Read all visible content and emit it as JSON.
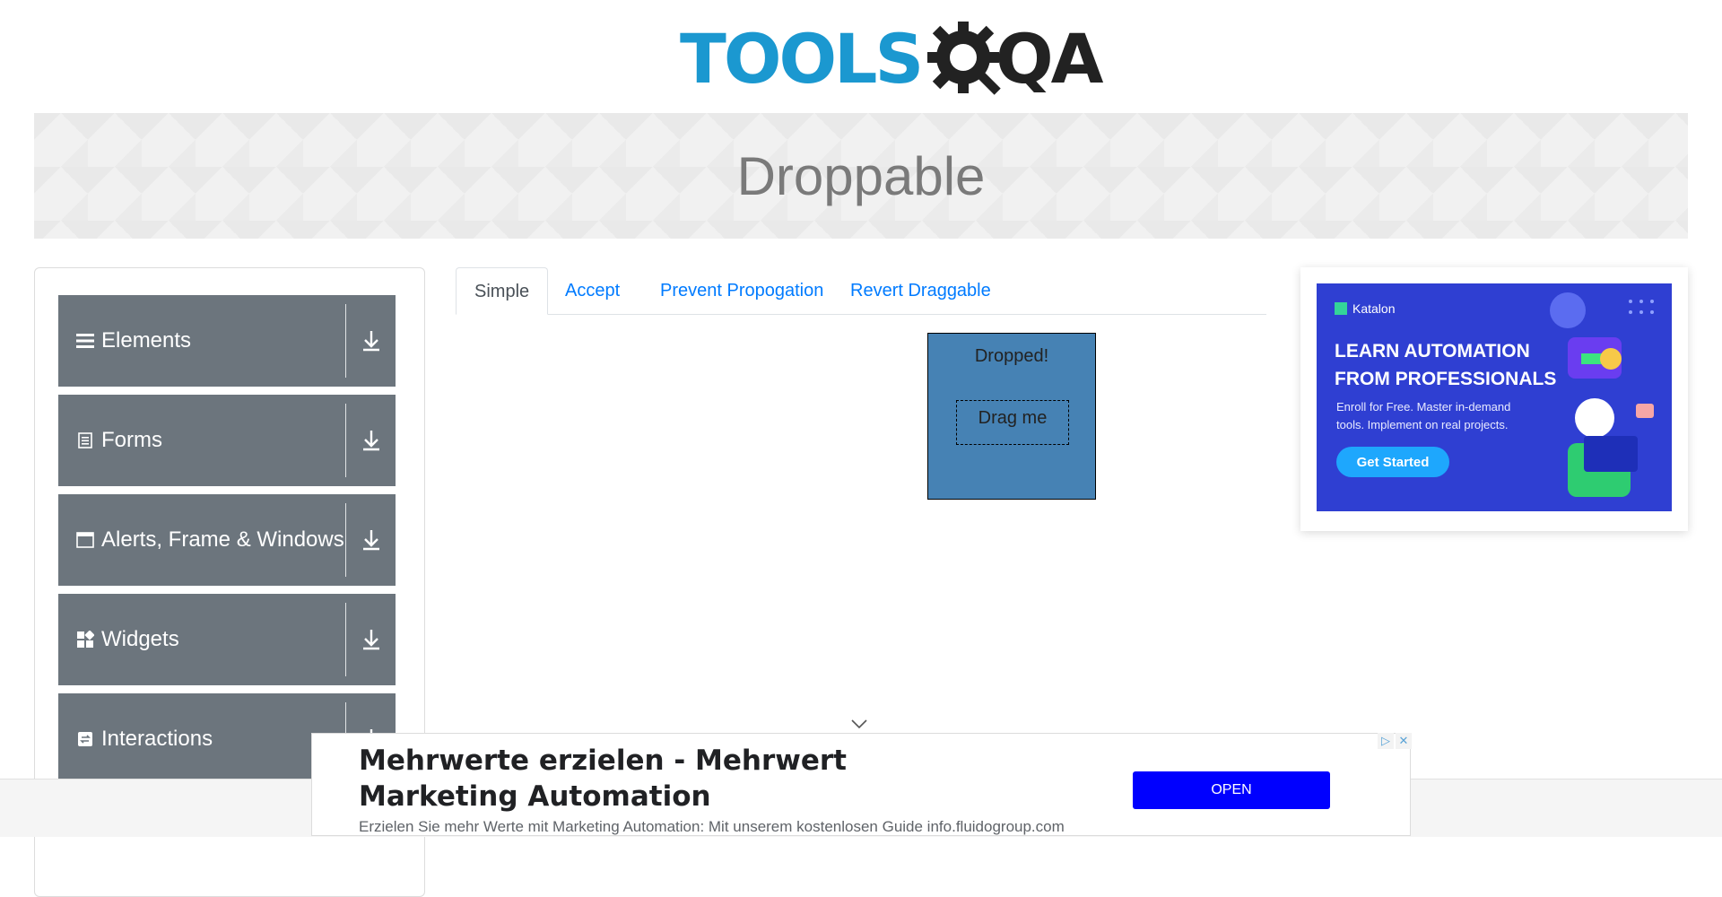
{
  "logo": {
    "part1": "TOOLS",
    "part2": "QA"
  },
  "banner": {
    "title": "Droppable"
  },
  "sidebar": {
    "items": [
      {
        "label": "Elements",
        "icon": "menu-icon"
      },
      {
        "label": "Forms",
        "icon": "document-icon"
      },
      {
        "label": "Alerts, Frame & Windows",
        "icon": "window-icon"
      },
      {
        "label": "Widgets",
        "icon": "widgets-icon"
      },
      {
        "label": "Interactions",
        "icon": "interactions-icon"
      }
    ]
  },
  "tabs": [
    {
      "label": "Simple",
      "active": true
    },
    {
      "label": "Accept"
    },
    {
      "label": "Prevent Propogation"
    },
    {
      "label": "Revert Draggable"
    }
  ],
  "droppable": {
    "drop_text": "Dropped!",
    "drag_text": "Drag me",
    "drop_color": "#4682b4"
  },
  "right_ad": {
    "brand": "Katalon",
    "headline": "LEARN AUTOMATION FROM PROFESSIONALS",
    "sub": "Enroll for Free. Master in-demand tools. Implement on real projects.",
    "button": "Get Started"
  },
  "bottom_ad": {
    "title": "Mehrwerte erzielen - Mehrwert Marketing Automation",
    "description": "Erzielen Sie mehr Werte mit Marketing Automation: Mit unserem kostenlosen Guide info.fluidogroup.com",
    "open_label": "OPEN"
  },
  "colors": {
    "accent": "#007bff",
    "menu_bg": "#6c757d",
    "logo_blue": "#1b98d0"
  }
}
